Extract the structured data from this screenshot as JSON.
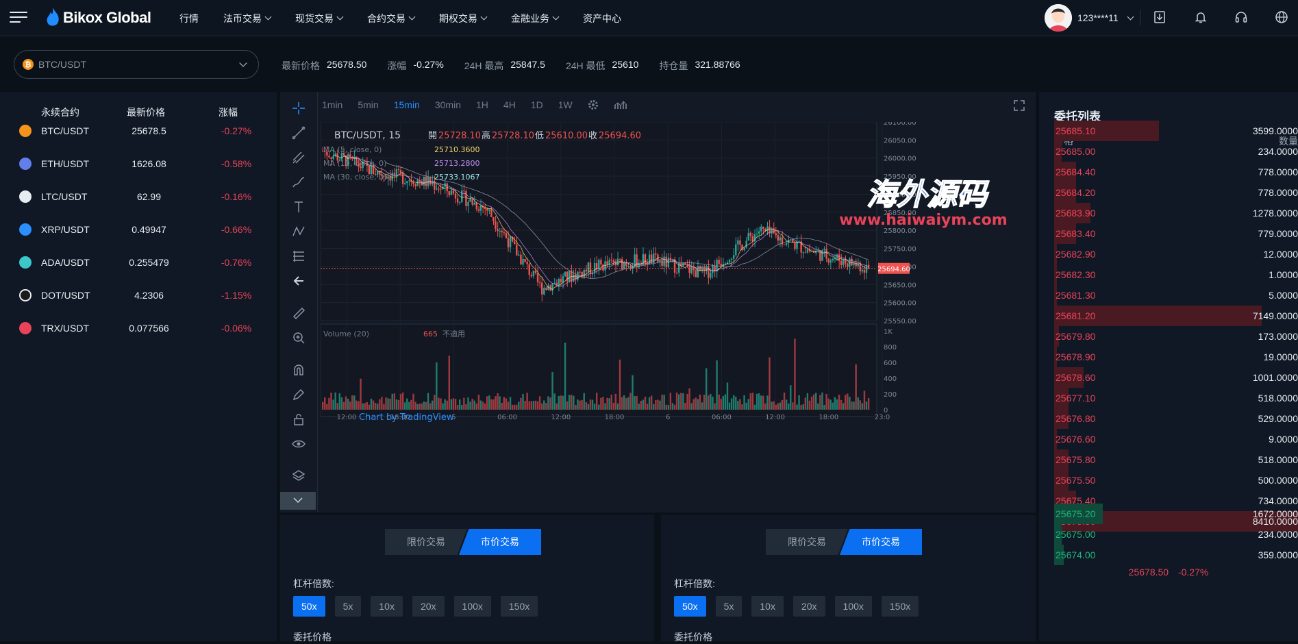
{
  "header": {
    "logo_text": "Bikox Global",
    "nav": [
      {
        "label": "行情",
        "has_menu": false
      },
      {
        "label": "法币交易",
        "has_menu": true
      },
      {
        "label": "现货交易",
        "has_menu": true
      },
      {
        "label": "合约交易",
        "has_menu": true
      },
      {
        "label": "期权交易",
        "has_menu": true
      },
      {
        "label": "金融业务",
        "has_menu": true
      },
      {
        "label": "资产中心",
        "has_menu": false
      }
    ],
    "user": "123****11",
    "icons": [
      "download-icon",
      "bell-icon",
      "headset-icon",
      "globe-icon"
    ]
  },
  "ticker": {
    "pair": "BTC/USDT",
    "last_label": "最新价格",
    "last": "25678.50",
    "change_label": "涨幅",
    "change": "-0.27%",
    "high_label": "24H 最高",
    "high": "25847.5",
    "low_label": "24H 最低",
    "low": "25610",
    "oi_label": "持仓量",
    "oi": "321.88766"
  },
  "markets": {
    "head_pair": "永续合约",
    "head_price": "最新价格",
    "head_change": "涨幅",
    "rows": [
      {
        "symbol": "BTC/USDT",
        "price": "25678.5",
        "change": "-0.27%",
        "color": "#f7931a"
      },
      {
        "symbol": "ETH/USDT",
        "price": "1626.08",
        "change": "-0.58%",
        "color": "#627eea"
      },
      {
        "symbol": "LTC/USDT",
        "price": "62.99",
        "change": "-0.16%",
        "color": "#e6ecf2"
      },
      {
        "symbol": "XRP/USDT",
        "price": "0.49947",
        "change": "-0.66%",
        "color": "#2b8fff"
      },
      {
        "symbol": "ADA/USDT",
        "price": "0.255479",
        "change": "-0.76%",
        "color": "#3cc8c8"
      },
      {
        "symbol": "DOT/USDT",
        "price": "4.2306",
        "change": "-1.15%",
        "color": "#1a1a1a"
      },
      {
        "symbol": "TRX/USDT",
        "price": "0.077566",
        "change": "-0.06%",
        "color": "#e94359"
      }
    ]
  },
  "chart": {
    "intervals": [
      "1min",
      "5min",
      "15min",
      "30min",
      "1H",
      "4H",
      "1D",
      "1W"
    ],
    "active_interval": "15min",
    "legend_symbol": "BTC/USDT, 15",
    "ohlc": {
      "open_label": "開",
      "open": "25728.10",
      "high_label": "高",
      "high": "25728.10",
      "low_label": "低",
      "low": "25610.00",
      "close_label": "收",
      "close": "25694.60"
    },
    "ma": [
      {
        "label": "MA (5, close, 0)",
        "value": "25710.3600",
        "color": "#f5d76e"
      },
      {
        "label": "MA (10, close, 0)",
        "value": "25713.2800",
        "color": "#c48ef7"
      },
      {
        "label": "MA (30, close, 0)",
        "value": "25733.1067",
        "color": "#9ee6e6"
      }
    ],
    "volume_label": "Volume (20)",
    "volume_value": "665",
    "volume_na": "不適用",
    "watermark": "Chart by TradingView",
    "last_price_tag": "25694.60",
    "price_axis": [
      "26100.00",
      "26050.00",
      "26000.00",
      "25950.00",
      "25900.00",
      "25850.00",
      "25800.00",
      "25750.00",
      "25700.00",
      "25650.00",
      "25600.00",
      "25550.00"
    ],
    "volume_axis": [
      "1K",
      "800",
      "600",
      "400",
      "200",
      "0"
    ],
    "time_axis": [
      "12:00",
      "18:00",
      "5",
      "06:00",
      "12:00",
      "18:00",
      "6",
      "06:00",
      "12:00",
      "18:00",
      "23:0"
    ]
  },
  "chart_data": {
    "type": "line",
    "title": "BTC/USDT, 15",
    "xlabel": "",
    "ylabel": "",
    "x": [
      "12:00",
      "18:00",
      "5",
      "06:00",
      "12:00",
      "18:00",
      "6",
      "06:00",
      "12:00",
      "18:00",
      "23:00"
    ],
    "series": [
      {
        "name": "",
        "values": [
          26020,
          25960,
          25930,
          25860,
          25640,
          25700,
          25720,
          25680,
          25800,
          25740,
          25694.6
        ]
      }
    ],
    "ylim": [
      25550,
      26100
    ],
    "volume_ylim": [
      0,
      1000
    ]
  },
  "overlay_watermark": {
    "title": "海外源码",
    "url": "www.haiwaiym.com"
  },
  "trade_left": {
    "tab_limit": "限价交易",
    "tab_market": "市价交易",
    "leverage_label": "杠杆倍数:",
    "leverage": [
      "50x",
      "5x",
      "10x",
      "20x",
      "100x",
      "150x"
    ],
    "active_leverage": "50x",
    "price_label": "委托价格"
  },
  "trade_right": {
    "tab_limit": "限价交易",
    "tab_market": "市价交易",
    "leverage_label": "杠杆倍数:",
    "leverage": [
      "50x",
      "5x",
      "10x",
      "20x",
      "100x",
      "150x"
    ],
    "active_leverage": "50x",
    "price_label": "委托价格"
  },
  "orderbook": {
    "title": "委托列表",
    "head_price": "价格",
    "head_qty": "数量",
    "asks": [
      {
        "price": "25685.10",
        "qty": "3599.0000",
        "depth": 0.43
      },
      {
        "price": "25685.00",
        "qty": "234.0000",
        "depth": 0.03
      },
      {
        "price": "25684.40",
        "qty": "778.0000",
        "depth": 0.09
      },
      {
        "price": "25684.20",
        "qty": "778.0000",
        "depth": 0.09
      },
      {
        "price": "25683.90",
        "qty": "1278.0000",
        "depth": 0.15
      },
      {
        "price": "25683.40",
        "qty": "779.0000",
        "depth": 0.09
      },
      {
        "price": "25682.90",
        "qty": "12.0000",
        "depth": 0.01
      },
      {
        "price": "25682.30",
        "qty": "1.0000",
        "depth": 0.01
      },
      {
        "price": "25681.30",
        "qty": "5.0000",
        "depth": 0.01
      },
      {
        "price": "25681.20",
        "qty": "7149.0000",
        "depth": 0.85
      },
      {
        "price": "25679.80",
        "qty": "173.0000",
        "depth": 0.02
      },
      {
        "price": "25678.90",
        "qty": "19.0000",
        "depth": 0.01
      },
      {
        "price": "25678.60",
        "qty": "1001.0000",
        "depth": 0.12
      },
      {
        "price": "25677.10",
        "qty": "518.0000",
        "depth": 0.06
      },
      {
        "price": "25676.80",
        "qty": "529.0000",
        "depth": 0.06
      },
      {
        "price": "25676.60",
        "qty": "9.0000",
        "depth": 0.01
      },
      {
        "price": "25675.80",
        "qty": "518.0000",
        "depth": 0.06
      },
      {
        "price": "25675.50",
        "qty": "500.0000",
        "depth": 0.06
      },
      {
        "price": "25675.40",
        "qty": "734.0000",
        "depth": 0.09
      },
      {
        "price": "25675.30",
        "qty": "8410.0000",
        "depth": 1.0
      }
    ],
    "mid_price": "25678.50",
    "mid_change": "-0.27%",
    "bids": [
      {
        "price": "25675.20",
        "qty": "1672.0000",
        "depth": 0.2
      },
      {
        "price": "25675.00",
        "qty": "234.0000",
        "depth": 0.03
      },
      {
        "price": "25674.00",
        "qty": "359.0000",
        "depth": 0.04
      }
    ]
  }
}
